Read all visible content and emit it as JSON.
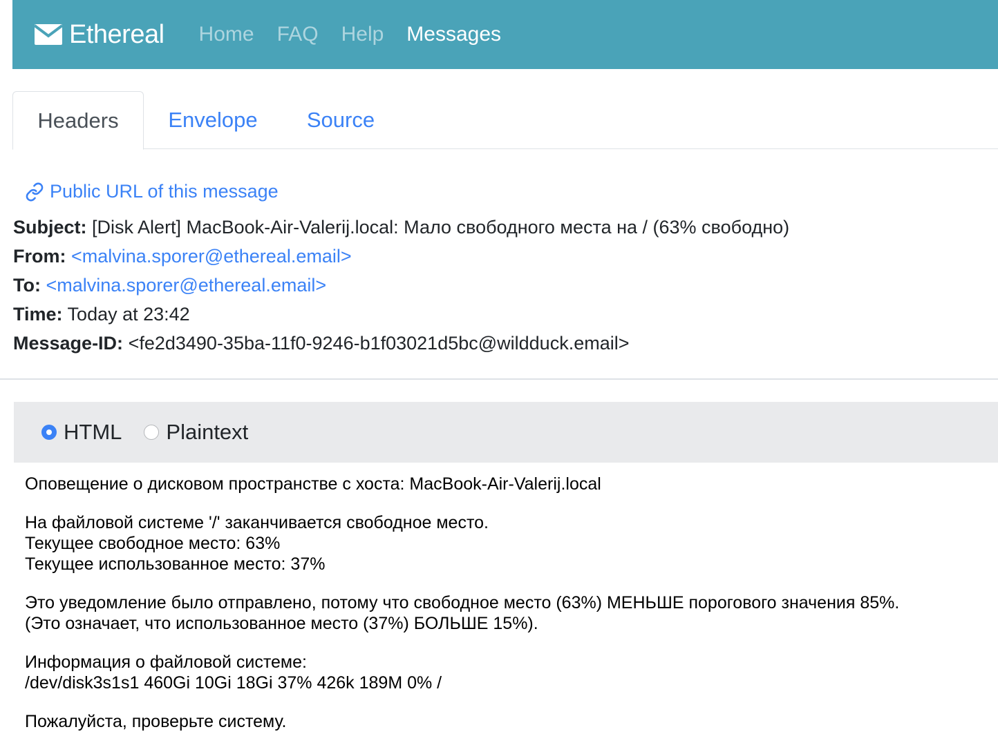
{
  "navbar": {
    "brand": "Ethereal",
    "links": [
      {
        "label": "Home",
        "active": false
      },
      {
        "label": "FAQ",
        "active": false
      },
      {
        "label": "Help",
        "active": false
      },
      {
        "label": "Messages",
        "active": true
      }
    ],
    "accent_color": "#4aa3b8"
  },
  "tabs": [
    {
      "label": "Headers",
      "active": true
    },
    {
      "label": "Envelope",
      "active": false
    },
    {
      "label": "Source",
      "active": false
    }
  ],
  "message": {
    "public_url_label": "Public URL of this message",
    "subject_label": "Subject:",
    "subject": "[Disk Alert] MacBook-Air-Valerij.local: Мало свободного места на / (63% свободно)",
    "from_label": "From:",
    "from": "<malvina.sporer@ethereal.email>",
    "to_label": "To:",
    "to": "<malvina.sporer@ethereal.email>",
    "time_label": "Time:",
    "time": "Today at 23:42",
    "message_id_label": "Message-ID:",
    "message_id": "<fe2d3490-35ba-11f0-9246-b1f03021d5bc@wildduck.email>"
  },
  "format": {
    "options": [
      {
        "label": "HTML",
        "selected": true
      },
      {
        "label": "Plaintext",
        "selected": false
      }
    ]
  },
  "body": {
    "line1": "Оповещение о дисковом пространстве с хоста: MacBook-Air-Valerij.local",
    "line2": "На файловой системе '/' заканчивается свободное место.",
    "line3": "Текущее свободное место: 63%",
    "line4": "Текущее использованное место: 37%",
    "line5": "Это уведомление было отправлено, потому что свободное место (63%) МЕНЬШЕ порогового значения 85%.",
    "line6": "(Это означает, что использованное место (37%) БОЛЬШЕ 15%).",
    "line7": "Информация о файловой системе:",
    "line8": "/dev/disk3s1s1 460Gi 10Gi 18Gi 37% 426k 189M 0% /",
    "line9": "Пожалуйста, проверьте систему."
  }
}
